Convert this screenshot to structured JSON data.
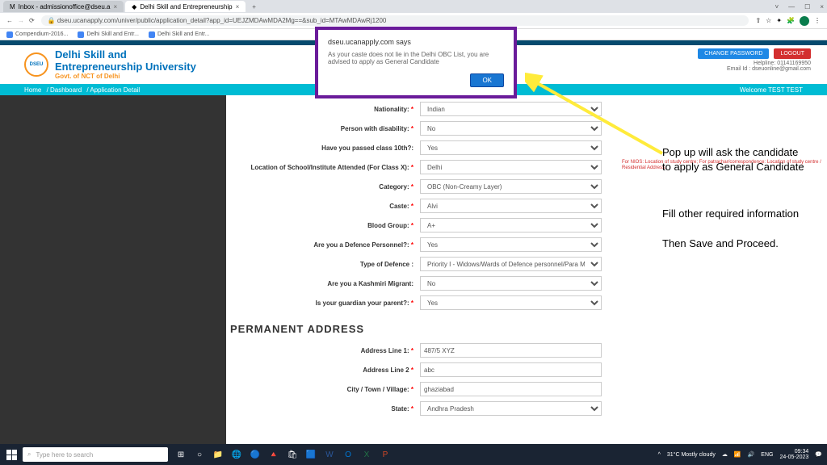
{
  "browser": {
    "tabs": [
      {
        "title": "Inbox - admissionoffice@dseu.a"
      },
      {
        "title": "Delhi Skill and Entrepreneurship"
      }
    ],
    "url": "dseu.ucanapply.com/univer/public/application_detail?app_id=UEJZMDAwMDA2Mg==&sub_id=MTAwMDAwRj1200",
    "bookmarks": [
      "Compendium-2016...",
      "Delhi Skill and Entr...",
      "Delhi Skill and Entr..."
    ]
  },
  "header": {
    "uni1": "Delhi Skill and",
    "uni2": "Entrepreneurship University",
    "govt": "Govt. of NCT of Delhi",
    "logo_text": "DSEU",
    "change_pwd": "CHANGE PASSWORD",
    "logout": "LOGOUT",
    "helpline": "Helpline: 01141169950",
    "email": "Email Id : dseuonline@gmail.com"
  },
  "nav": {
    "home": "Home",
    "dash": "Dashboard",
    "detail": "Application Detail",
    "welcome": "Welcome TEST TEST"
  },
  "form": {
    "nationality": {
      "label": "Nationality:",
      "value": "Indian"
    },
    "disability": {
      "label": "Person with disability:",
      "value": "No"
    },
    "class10": {
      "label": "Have you passed class 10th?:",
      "value": "Yes"
    },
    "school_loc": {
      "label": "Location of School/Institute Attended (For Class X):",
      "value": "Delhi"
    },
    "category": {
      "label": "Category:",
      "value": "OBC (Non-Creamy Layer)"
    },
    "caste": {
      "label": "Caste:",
      "value": "Alvi"
    },
    "blood": {
      "label": "Blood Group:",
      "value": "A+"
    },
    "defence": {
      "label": "Are you a Defence Personnel?:",
      "value": "Yes"
    },
    "def_type": {
      "label": "Type of Defence :",
      "value": "Priority I - Widows/Wards of Defence personnel/Para Military"
    },
    "kashmiri": {
      "label": "Are you a Kashmiri Migrant:",
      "value": "No"
    },
    "guardian": {
      "label": "Is your guardian your parent?:",
      "value": "Yes"
    },
    "address_hdr": "PERMANENT ADDRESS",
    "addr1": {
      "label": "Address Line 1:",
      "value": "487/5 XYZ"
    },
    "addr2": {
      "label": "Address Line 2",
      "value": "abc"
    },
    "city": {
      "label": "City / Town / Village:",
      "value": "ghaziabad"
    },
    "state": {
      "label": "State:",
      "value": "Andhra Pradesh"
    },
    "note": "For NIOS: Location of study centre; For patrachar/correspondence: Location of study centre / Residential Address."
  },
  "modal": {
    "title": "dseu.ucanapply.com says",
    "msg": "As your caste does not lie in the Delhi OBC List, you are advised to apply as General Candidate",
    "ok": "OK"
  },
  "annotations": {
    "a1": "Pop up will ask the candidate to apply as General Candidate",
    "a2": "Fill other required information",
    "a3": "Then Save and Proceed."
  },
  "taskbar": {
    "search": "Type here to search",
    "weather": "31°C  Mostly cloudy",
    "time": "09:34",
    "date": "24-05-2023",
    "lang": "ENG"
  }
}
